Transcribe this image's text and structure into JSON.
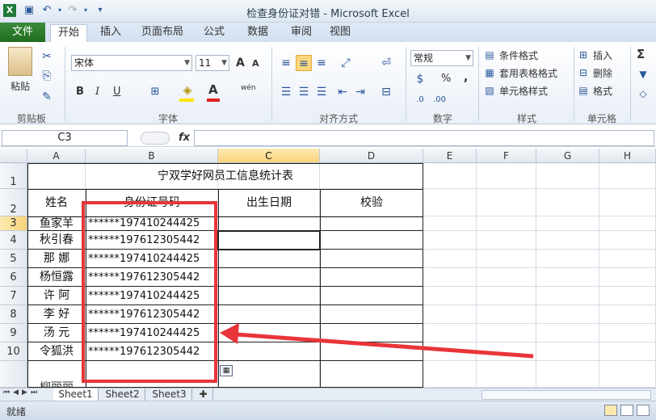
{
  "window": {
    "title": "检查身份证对错 - Microsoft Excel"
  },
  "tabs": {
    "file": "文件",
    "home": "开始",
    "insert": "插入",
    "layout": "页面布局",
    "formulas": "公式",
    "data": "数据",
    "review": "审阅",
    "view": "视图"
  },
  "ribbon": {
    "clipboard": {
      "paste": "粘贴",
      "label": "剪贴板"
    },
    "font": {
      "name": "宋体",
      "size": "11",
      "bold": "B",
      "italic": "I",
      "underline": "U",
      "grow": "A",
      "shrink": "A",
      "phonetic": "wén",
      "label": "字体"
    },
    "alignment": {
      "label": "对齐方式"
    },
    "number": {
      "format": "常规",
      "percent": "%",
      "comma": ",",
      "label": "数字"
    },
    "styles": {
      "conditional": "条件格式",
      "table": "套用表格格式",
      "cell": "单元格样式",
      "label": "样式"
    },
    "cells": {
      "insert": "插入",
      "delete": "删除",
      "format": "格式",
      "label": "单元格"
    },
    "editing": {
      "sum": "Σ"
    }
  },
  "formula_bar": {
    "name_box": "C3",
    "fx": "fx",
    "value": ""
  },
  "columns": [
    "A",
    "B",
    "C",
    "D",
    "E",
    "F",
    "G",
    "H"
  ],
  "rows": [
    "1",
    "2",
    "3",
    "4",
    "5",
    "6",
    "7",
    "8",
    "9",
    "10"
  ],
  "sheet": {
    "title": "宁双学好网员工信息统计表",
    "headers": [
      "姓名",
      "身份证号码",
      "出生日期",
      "校验"
    ],
    "records": [
      {
        "name": "鱼家羊",
        "id": "******197410244425"
      },
      {
        "name": "秋引春",
        "id": "******197612305442"
      },
      {
        "name": "那  娜",
        "id": "******197410244425"
      },
      {
        "name": "杨恒露",
        "id": "******197612305442"
      },
      {
        "name": "许  阿",
        "id": "******197410244425"
      },
      {
        "name": "李  好",
        "id": "******197612305442"
      },
      {
        "name": "汤  元",
        "id": "******197410244425"
      },
      {
        "name": "令狐洪",
        "id": "******197612305442"
      }
    ],
    "partial_row": "柳丽丽"
  },
  "sheet_tabs": [
    "Sheet1",
    "Sheet2",
    "Sheet3"
  ],
  "status": {
    "ready": "就绪"
  },
  "colors": {
    "highlight": "#e8353a",
    "file_tab": "#2a7d2a",
    "selected_header": "#f9d37a"
  }
}
